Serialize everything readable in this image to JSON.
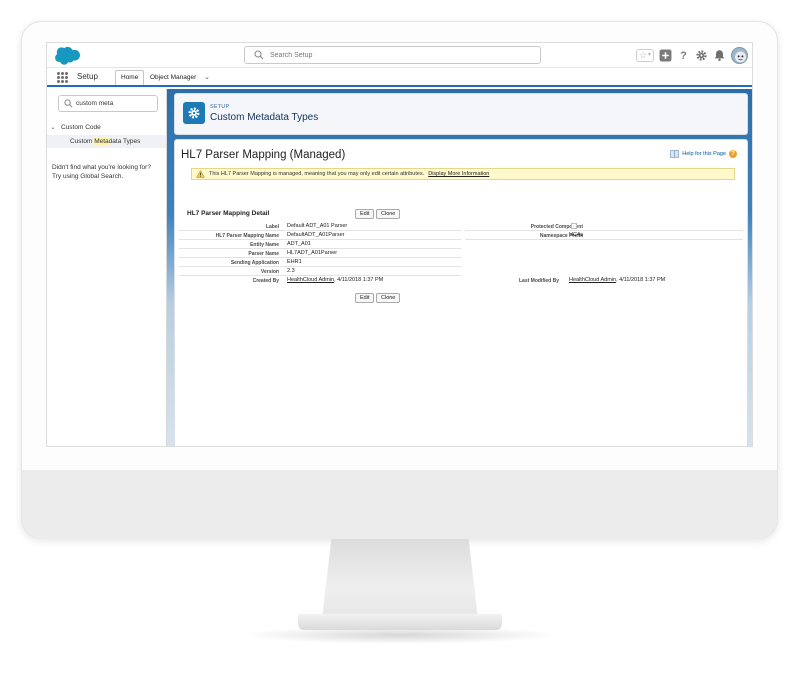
{
  "header": {
    "search_placeholder": "Search Setup"
  },
  "nav": {
    "app_name": "Setup",
    "tabs": [
      {
        "label": "Home"
      },
      {
        "label": "Object Manager"
      }
    ]
  },
  "sidebar": {
    "quickfind_value": "custom meta",
    "tree": {
      "parent_label": "Custom Code",
      "child_label_before": "Custom ",
      "child_label_highlight": "Meta",
      "child_label_after": "data Types"
    },
    "help_line1": "Didn't find what you're looking for?",
    "help_line2": "Try using Global Search."
  },
  "setup_header": {
    "eyebrow": "SETUP",
    "title": "Custom Metadata Types"
  },
  "detail": {
    "title": "HL7 Parser Mapping (Managed)",
    "help_link": "Help for this Page",
    "notice_text": "This HL7 Parser Mapping is managed, meaning that you may only edit certain attributes.",
    "notice_link": "Display More Information",
    "section_title": "HL7 Parser Mapping Detail",
    "edit_label": "Edit",
    "clone_label": "Clone",
    "fields": {
      "label": {
        "label": "Label",
        "value": "Default ADT_A01 Parser"
      },
      "mapping_name": {
        "label": "HL7 Parser Mapping Name",
        "value": "DefaultADT_A01Parser"
      },
      "entity_name": {
        "label": "Entity Name",
        "value": "ADT_A01"
      },
      "parser_name": {
        "label": "Parser Name",
        "value": "HL7ADT_A01Parser"
      },
      "sending_app": {
        "label": "Sending Application",
        "value": "EHR1"
      },
      "version": {
        "label": "Version",
        "value": "2.3"
      },
      "created_by": {
        "label": "Created By",
        "user": "HealthCloud Admin",
        "date": ", 4/11/2018 1:37 PM"
      },
      "protected": {
        "label": "Protected Component"
      },
      "namespace": {
        "label": "Namespace Prefix",
        "value": "HC4a"
      },
      "modified_by": {
        "label": "Last Modified By",
        "user": "HealthCloud Admin",
        "date": ", 4/11/2018 1:37 PM"
      }
    }
  },
  "colors": {
    "brand_blue": "#1f6fb8",
    "setup_icon": "#1d7ab5",
    "notice_bg": "#fff9cc"
  }
}
